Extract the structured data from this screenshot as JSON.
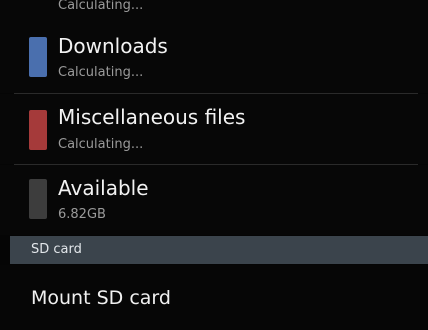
{
  "storage_list": {
    "partial_item": {
      "subtitle": "Calculating..."
    },
    "items": [
      {
        "title": "Downloads",
        "subtitle": "Calculating...",
        "color": "#4a6fae"
      },
      {
        "title": "Miscellaneous files",
        "subtitle": "Calculating...",
        "color": "#a53a3a"
      },
      {
        "title": "Available",
        "subtitle": "6.82GB",
        "color": "#3d3d3d"
      }
    ]
  },
  "sd_section": {
    "header": "SD card",
    "mount_label": "Mount SD card"
  },
  "colors": {
    "background": "#000000",
    "section_header_bg": "#3b444c"
  }
}
